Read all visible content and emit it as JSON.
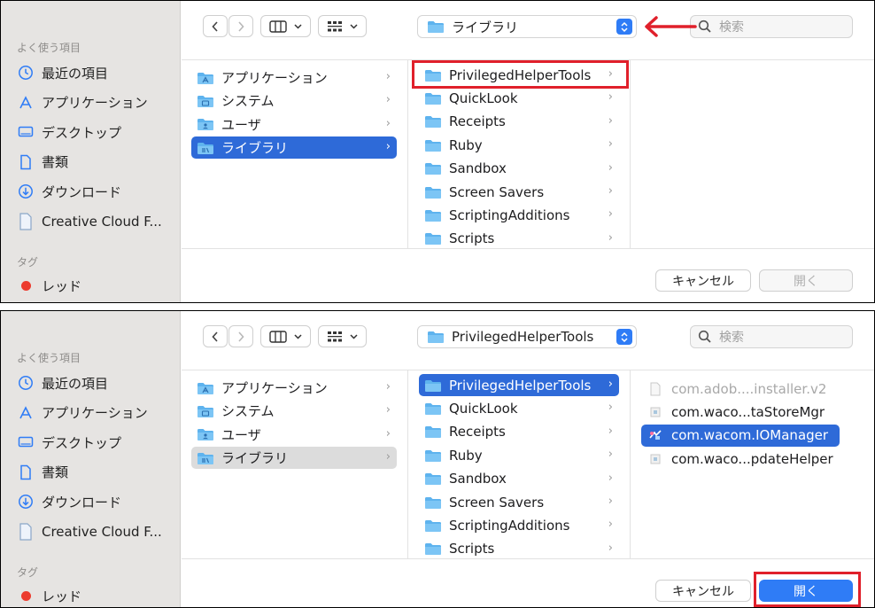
{
  "sidebar": {
    "favorites_heading": "よく使う項目",
    "items": [
      {
        "label": "最近の項目",
        "icon": "clock-icon"
      },
      {
        "label": "アプリケーション",
        "icon": "apps-icon"
      },
      {
        "label": "デスクトップ",
        "icon": "desktop-icon"
      },
      {
        "label": "書類",
        "icon": "document-icon"
      },
      {
        "label": "ダウンロード",
        "icon": "download-icon"
      },
      {
        "label": "Creative Cloud F...",
        "icon": "file-icon"
      }
    ],
    "tags_heading": "タグ",
    "tag": {
      "label": "レッド",
      "color": "#ec3b2e"
    }
  },
  "panel1": {
    "path_selector": "ライブラリ",
    "search_placeholder": "検索",
    "col1": [
      "アプリケーション",
      "システム",
      "ユーザ",
      "ライブラリ"
    ],
    "col2": [
      "PrivilegedHelperTools",
      "QuickLook",
      "Receipts",
      "Ruby",
      "Sandbox",
      "Screen Savers",
      "ScriptingAdditions",
      "Scripts"
    ],
    "cancel": "キャンセル",
    "open": "開く"
  },
  "panel2": {
    "path_selector": "PrivilegedHelperTools",
    "search_placeholder": "検索",
    "col1": [
      "アプリケーション",
      "システム",
      "ユーザ",
      "ライブラリ"
    ],
    "col2": [
      "PrivilegedHelperTools",
      "QuickLook",
      "Receipts",
      "Ruby",
      "Sandbox",
      "Screen Savers",
      "ScriptingAdditions",
      "Scripts"
    ],
    "col3": [
      "com.adob....installer.v2",
      "com.waco...taStoreMgr",
      "com.wacom.IOManager",
      "com.waco...pdateHelper"
    ],
    "cancel": "キャンセル",
    "open": "開く"
  },
  "colors": {
    "accent": "#2f7cf6",
    "selection": "#2e6ad8",
    "annotation": "#e0202b",
    "folder": "#5eb3ee"
  }
}
